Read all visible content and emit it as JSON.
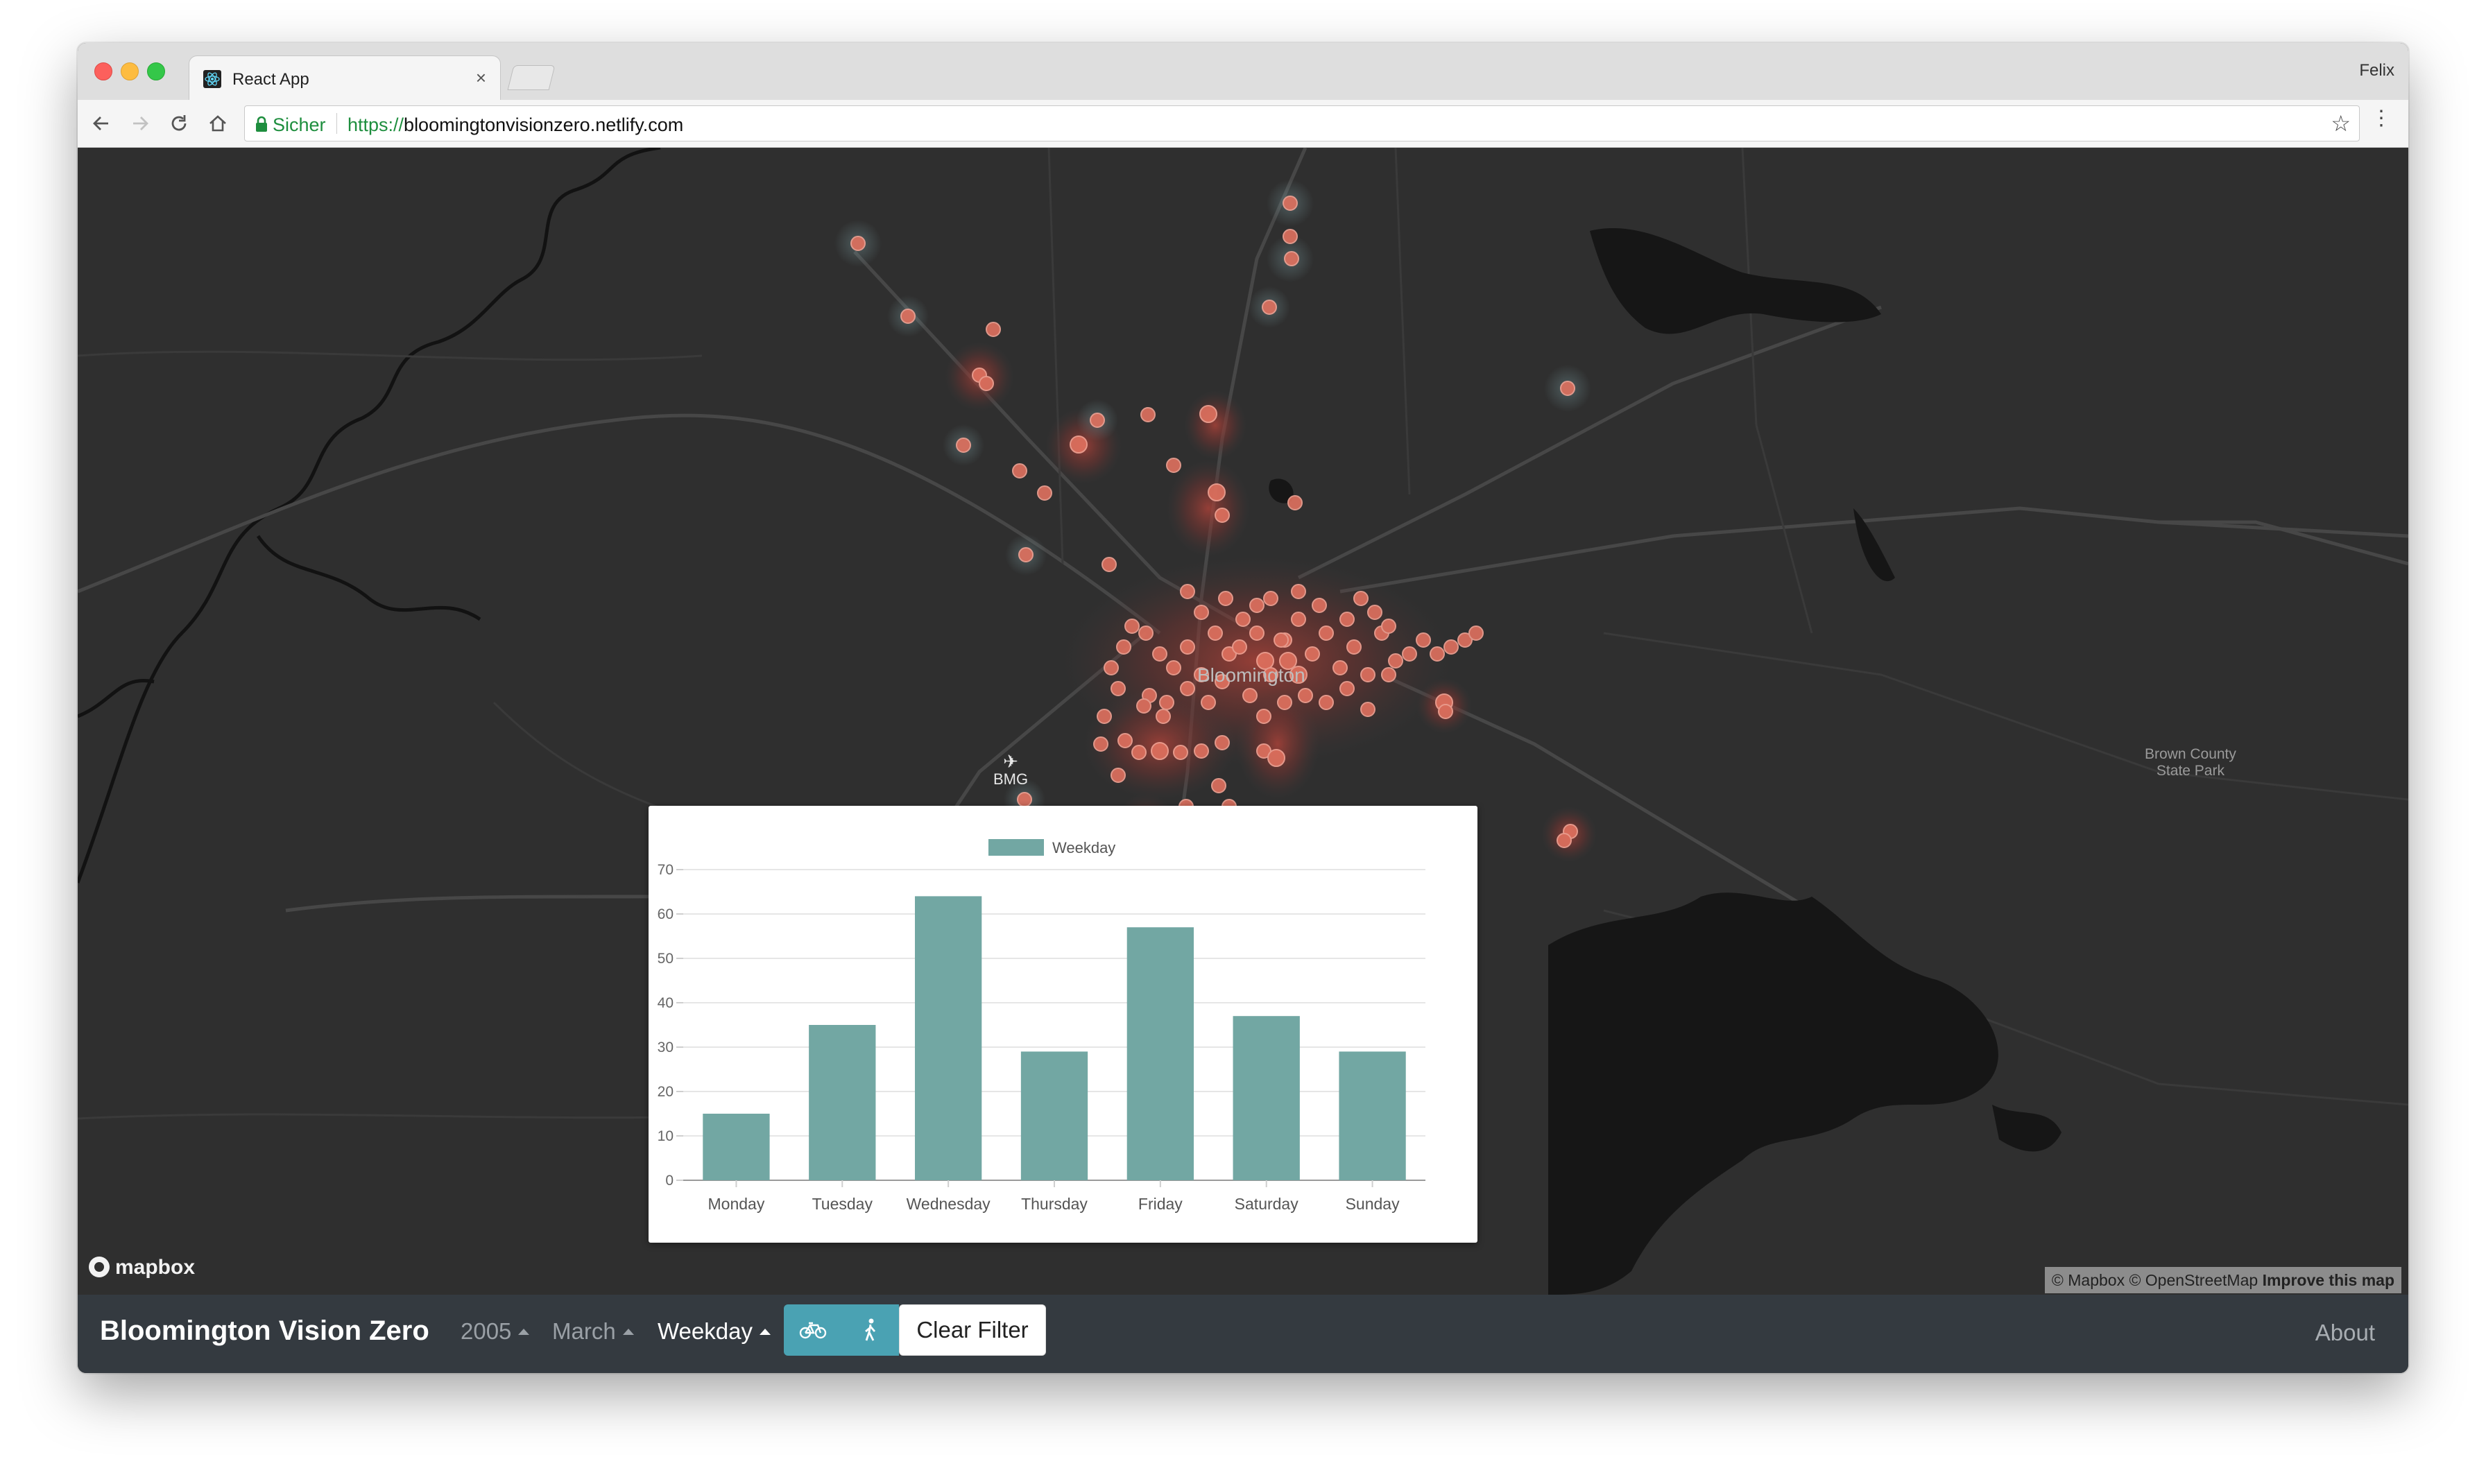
{
  "browser": {
    "tab_title": "React App",
    "tab_close": "×",
    "profile_name": "Felix",
    "secure_label": "Sicher",
    "url_scheme": "https://",
    "url_host": "bloomingtonvisionzero.netlify.com"
  },
  "map": {
    "city_label": "Bloomington",
    "airport_label": "BMG",
    "park_label_line1": "Brown County",
    "park_label_line2": "State Park",
    "logo_text": "mapbox",
    "attribution": "© Mapbox © OpenStreetMap",
    "improve_link": "Improve this map"
  },
  "navbar": {
    "brand": "Bloomington Vision Zero",
    "year_dropdown": "2005",
    "month_dropdown": "March",
    "day_dropdown": "Weekday",
    "bike_icon": "bicycle-icon",
    "pedestrian_icon": "pedestrian-icon",
    "clear_filter": "Clear Filter",
    "about": "About",
    "accent_color": "#4aa2b3"
  },
  "chart_data": {
    "type": "bar",
    "legend": [
      "Weekday"
    ],
    "categories": [
      "Monday",
      "Tuesday",
      "Wednesday",
      "Thursday",
      "Friday",
      "Saturday",
      "Sunday"
    ],
    "series": [
      {
        "name": "Weekday",
        "values": [
          15,
          35,
          64,
          29,
          57,
          37,
          29
        ]
      }
    ],
    "yticks": [
      0,
      10,
      20,
      30,
      40,
      50,
      60,
      70
    ],
    "ylim": [
      0,
      70
    ],
    "bar_color": "#72a7a3",
    "grid": true,
    "legend_position": "top"
  }
}
